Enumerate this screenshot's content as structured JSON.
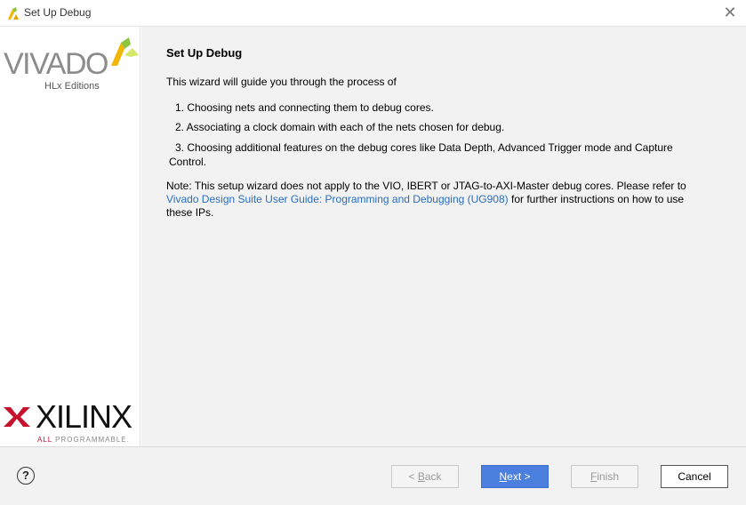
{
  "window": {
    "title": "Set Up Debug",
    "close_glyph": "✕"
  },
  "sidebar": {
    "vivado_logo_text": "VIVADO",
    "vivado_subtitle": "HLx Editions",
    "xilinx_logo_text": "XILINX",
    "xilinx_tagline_prefix": "ALL",
    "xilinx_tagline_rest": " PROGRAMMABLE."
  },
  "content": {
    "title": "Set Up Debug",
    "intro": "This wizard will guide you through the process of",
    "steps": [
      "1.  Choosing nets and connecting them to debug cores.",
      "2.  Associating a clock domain with each of the nets chosen for debug.",
      "3.  Choosing additional features on the debug cores like Data Depth, Advanced Trigger mode and Capture"
    ],
    "step3_continued": "Control.",
    "note_prefix": "Note: This setup wizard does not apply to the VIO, IBERT or JTAG-to-AXI-Master debug cores. Please refer to",
    "note_link": "Vivado Design Suite User Guide: Programming and Debugging (UG908)",
    "note_suffix": "for further instructions on how to use these IPs."
  },
  "footer": {
    "help_label": "?",
    "buttons": {
      "back_prefix": "< ",
      "back_mnemonic": "B",
      "back_rest": "ack",
      "next_mnemonic": "N",
      "next_rest": "ext >",
      "finish_mnemonic": "F",
      "finish_rest": "inish",
      "cancel": "Cancel"
    },
    "states": {
      "back": "disabled",
      "next": "default",
      "finish": "disabled",
      "cancel": "enabled"
    }
  },
  "colors": {
    "link": "#2a6ebd",
    "primary_button": "#4a7fde",
    "xilinx_red": "#c6102e",
    "vivado_yellow": "#f2b705",
    "vivado_green": "#8cc63f"
  },
  "icons": {
    "title_icon": "vivado-icon",
    "close": "close-icon",
    "help": "help-icon"
  }
}
